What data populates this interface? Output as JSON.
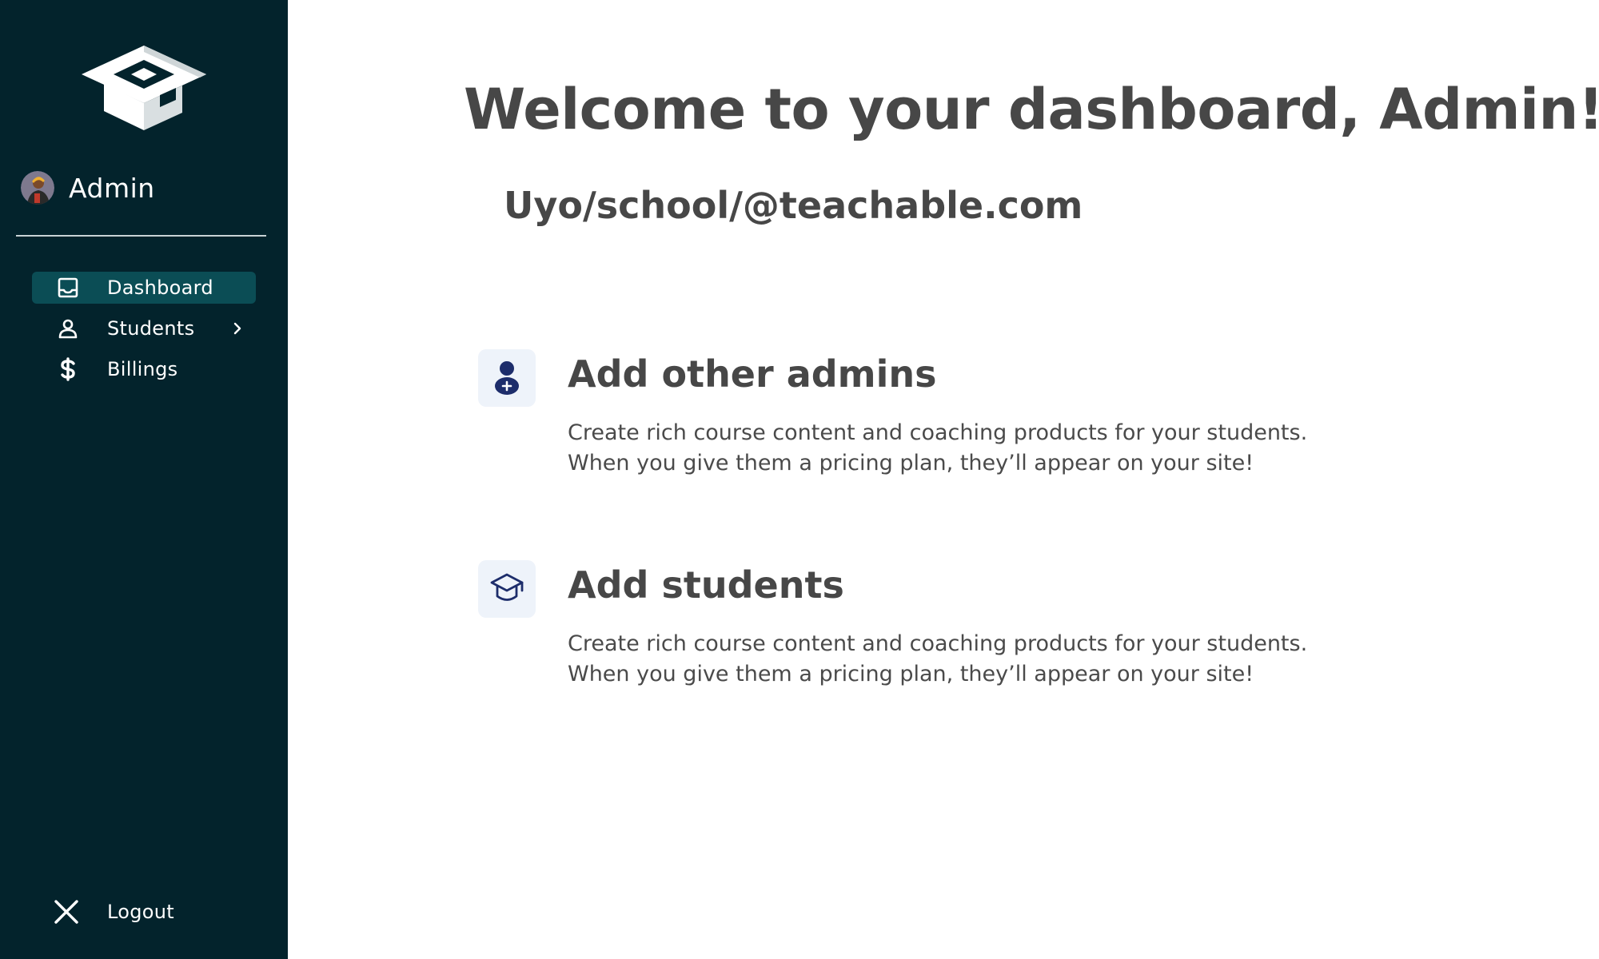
{
  "sidebar": {
    "profile": {
      "name": "Admin"
    },
    "nav": [
      {
        "label": "Dashboard",
        "icon": "inbox-icon",
        "active": true
      },
      {
        "label": "Students",
        "icon": "user-icon",
        "has_submenu": true
      },
      {
        "label": "Billings",
        "icon": "dollar-icon"
      }
    ],
    "logout_label": "Logout"
  },
  "main": {
    "welcome_title": "Welcome to your dashboard, Admin!",
    "school_email": "Uyo/school/@teachable.com",
    "features": [
      {
        "title": "Add other admins",
        "icon": "user-add-icon",
        "description_lines": [
          "Create rich course content and coaching products for your students.",
          "When you give them a pricing plan, they’ll appear on your site!"
        ]
      },
      {
        "title": "Add students",
        "icon": "graduation-cap-icon",
        "description_lines": [
          "Create rich course content and coaching products for your students.",
          "When you give them a pricing plan, they’ll appear on your site!"
        ]
      }
    ]
  },
  "colors": {
    "sidebar_bg": "#03232c",
    "active_nav_bg": "#0b4d55",
    "heading_text": "#474747",
    "icon_tile_bg": "#eef3fa",
    "icon_navy": "#1d2d6b"
  }
}
